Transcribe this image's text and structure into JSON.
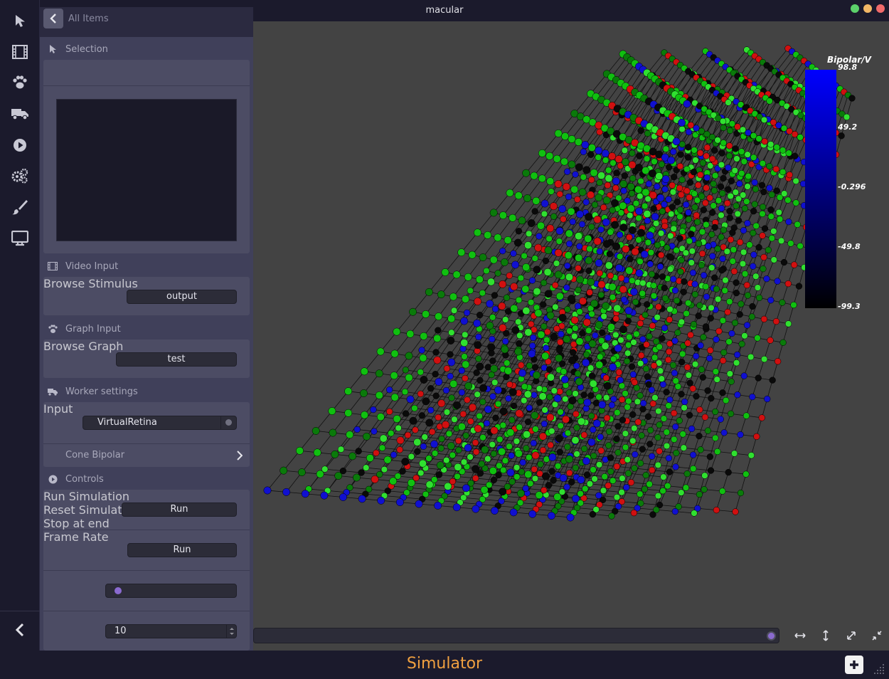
{
  "window": {
    "title": "macular"
  },
  "panel": {
    "back_label": "All Items",
    "sections": {
      "selection": "Selection",
      "video_input": "Video Input",
      "graph_input": "Graph Input",
      "worker_settings": "Worker settings",
      "controls": "Controls"
    },
    "video": {
      "browse_label": "Browse Stimulus",
      "browse_value": "output"
    },
    "graph": {
      "browse_label": "Browse Graph",
      "browse_value": "test"
    },
    "worker": {
      "input_label": "Input",
      "input_value": "VirtualRetina",
      "sub_item": "Cone Bipolar"
    },
    "controls": {
      "run_label": "Run Simulation",
      "run_button": "Run",
      "reset_label": "Reset Simulation",
      "reset_button": "Run",
      "stop_label": "Stop at end",
      "frame_label": "Frame Rate",
      "frame_value": "10"
    }
  },
  "colorbar": {
    "title": "Bipolar/V",
    "ticks": [
      "98.8",
      "49.2",
      "-0.296",
      "-49.8",
      "-99.3"
    ]
  },
  "bottom": {
    "mode": "Simulator"
  },
  "colors": {
    "accent": "#f0a040",
    "panel": "#40405a",
    "viewport": "#434343"
  }
}
